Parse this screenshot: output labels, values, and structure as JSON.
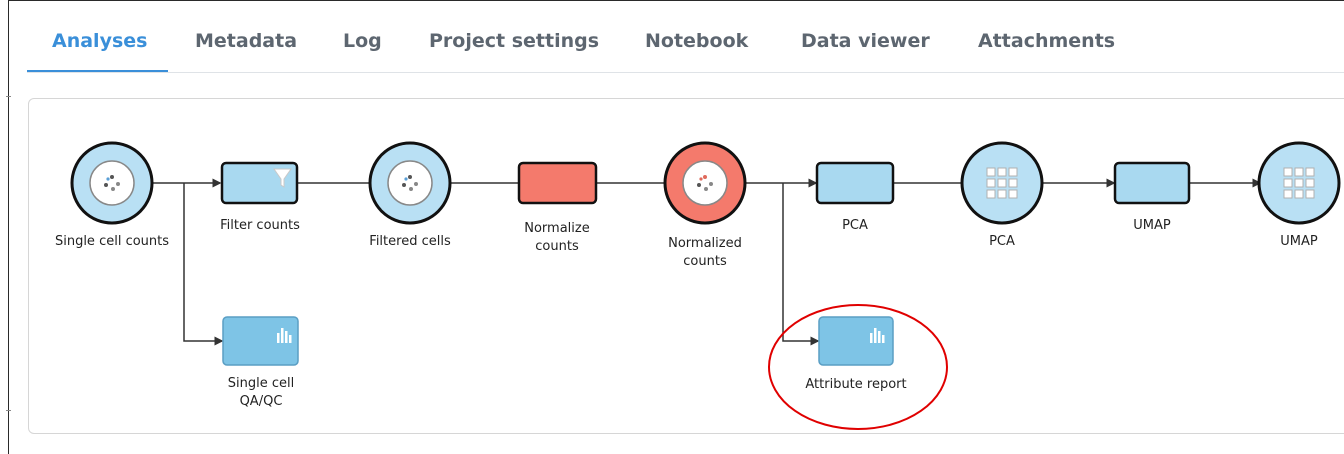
{
  "tabs": [
    {
      "label": "Analyses",
      "active": true
    },
    {
      "label": "Metadata"
    },
    {
      "label": "Log"
    },
    {
      "label": "Project settings"
    },
    {
      "label": "Notebook"
    },
    {
      "label": "Data viewer"
    },
    {
      "label": "Attachments"
    }
  ],
  "pipeline": {
    "nodes": {
      "single_cell_counts": "Single cell counts",
      "filter_counts": "Filter counts",
      "filtered_cells": "Filtered cells",
      "normalize_counts": [
        "Normalize",
        "counts"
      ],
      "normalized_counts": [
        "Normalized",
        "counts"
      ],
      "pca_task": "PCA",
      "pca_data": "PCA",
      "umap_task": "UMAP",
      "umap_data": "UMAP",
      "single_cell_qaqc": [
        "Single cell",
        "QA/QC"
      ],
      "attribute_report": "Attribute report"
    },
    "colors": {
      "data_node": "#b9e0f4",
      "task_node": "#a9d9f0",
      "report_node": "#7ec4e6",
      "highlight_node": "#f47a6c",
      "annotation_circle": "#e00000",
      "active_tab": "#3a8fd9"
    }
  }
}
